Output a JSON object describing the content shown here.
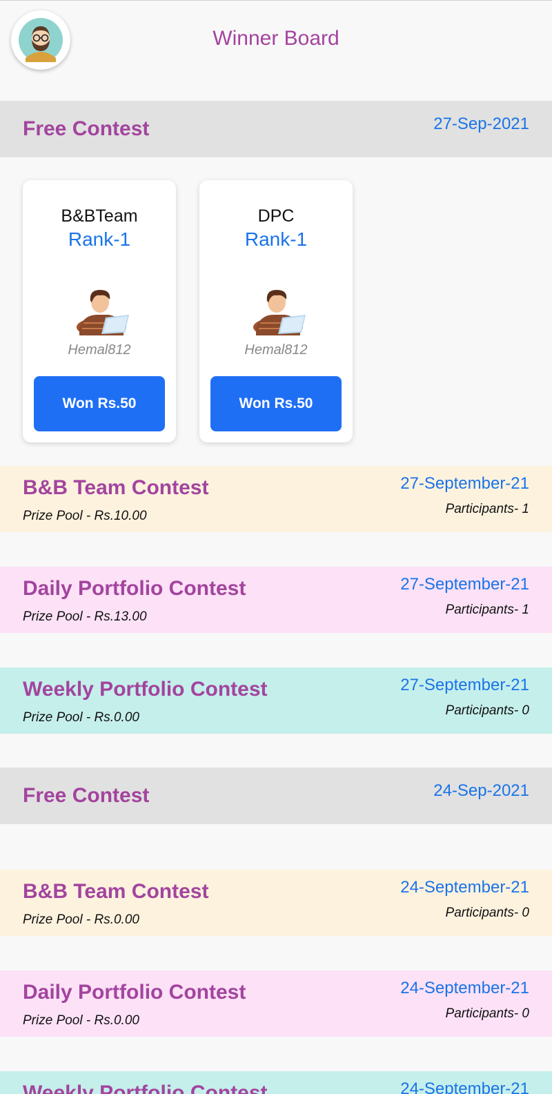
{
  "colors": {
    "title_purple": "#a3449e",
    "accent_blue": "#1a73e8",
    "button_blue": "#1f6ff5",
    "bg_team": "#fdf2de",
    "bg_daily": "#fce1f7",
    "bg_weekly": "#c5efeb"
  },
  "header": {
    "avatar_icon": "bearded-man-avatar-icon",
    "title": "Winner Board"
  },
  "sections": [
    {
      "title": "Free Contest",
      "date": "27-Sep-2021",
      "winners": [
        {
          "team": "B&BTeam",
          "rank": "Rank-1",
          "username": "Hemal812",
          "prize": "Won Rs.50"
        },
        {
          "team": "DPC",
          "rank": "Rank-1",
          "username": "Hemal812",
          "prize": "Won Rs.50"
        }
      ],
      "contests": [
        {
          "name": "B&B Team Contest",
          "prize_pool": "Prize Pool - Rs.10.00",
          "date": "27-September-21",
          "participants": "Participants- 1"
        },
        {
          "name": "Daily Portfolio Contest",
          "prize_pool": "Prize Pool - Rs.13.00",
          "date": "27-September-21",
          "participants": "Participants- 1"
        },
        {
          "name": "Weekly Portfolio Contest",
          "prize_pool": "Prize Pool - Rs.0.00",
          "date": "27-September-21",
          "participants": "Participants- 0"
        }
      ]
    },
    {
      "title": "Free Contest",
      "date": "24-Sep-2021",
      "contests": [
        {
          "name": "B&B Team Contest",
          "prize_pool": "Prize Pool - Rs.0.00",
          "date": "24-September-21",
          "participants": "Participants- 0"
        },
        {
          "name": "Daily Portfolio Contest",
          "prize_pool": "Prize Pool - Rs.0.00",
          "date": "24-September-21",
          "participants": "Participants- 0"
        },
        {
          "name": "Weekly Portfolio Contest",
          "date": "24-September-21"
        }
      ]
    }
  ]
}
